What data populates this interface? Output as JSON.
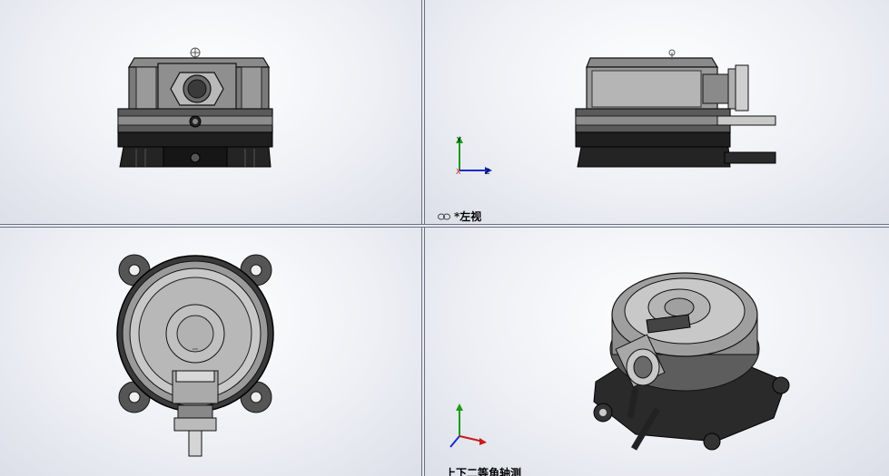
{
  "viewports": {
    "top_left": {
      "name": "front-view"
    },
    "top_right": {
      "name": "left-view",
      "label": "*左视"
    },
    "bottom_left": {
      "name": "bottom-view"
    },
    "bottom_right": {
      "name": "iso-view",
      "label": "上下二等角轴测"
    }
  },
  "triad": {
    "y": "Y",
    "z": "Z",
    "x": "X"
  },
  "colors": {
    "body_dark": "#1f1f1f",
    "body_mid": "#6b6b6b",
    "body_light": "#d0d0d0",
    "triad_y": "#1a9c1a",
    "triad_z": "#1a2cc8",
    "triad_x": "#c81a1a"
  },
  "icons": [
    "link-icon",
    "origin-icon"
  ]
}
